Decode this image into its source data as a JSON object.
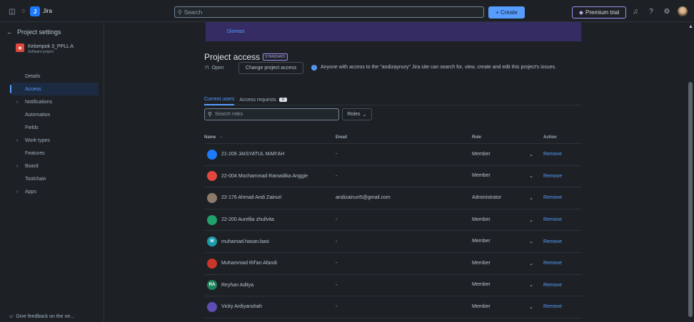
{
  "topbar": {
    "app_name": "Jira",
    "search_placeholder": "Search",
    "create_label": "+ Create",
    "premium_label": "Premium trial"
  },
  "sidebar": {
    "back_label": "Project settings",
    "project_name": "Kelompok 3_PPLL A",
    "project_type": "Software project",
    "items": [
      {
        "label": "Details",
        "chevron": false,
        "active": false
      },
      {
        "label": "Access",
        "chevron": false,
        "active": true
      },
      {
        "label": "Notifications",
        "chevron": true,
        "active": false
      },
      {
        "label": "Automation",
        "chevron": false,
        "active": false
      },
      {
        "label": "Fields",
        "chevron": false,
        "active": false
      },
      {
        "label": "Work types",
        "chevron": true,
        "active": false
      },
      {
        "label": "Features",
        "chevron": false,
        "active": false
      },
      {
        "label": "Board",
        "chevron": true,
        "active": false
      },
      {
        "label": "Toolchain",
        "chevron": false,
        "active": false
      },
      {
        "label": "Apps",
        "chevron": true,
        "active": false
      }
    ],
    "feedback_label": "Give feedback on the ne..."
  },
  "banner": {
    "dismiss_label": "Dismiss"
  },
  "access": {
    "title": "Project access",
    "badge": "STANDARD",
    "open_label": "Open",
    "change_label": "Change project access",
    "info_text": "Anyone with access to the \"andizaynury\" Jira site can search for, view, create and edit this project's issues."
  },
  "tabs": {
    "current_users": "Current users",
    "access_requests": "Access requests",
    "requests_count": "0"
  },
  "filters": {
    "search_placeholder": "Search roles",
    "roles_label": "Roles"
  },
  "table": {
    "headers": {
      "name": "Name",
      "email": "Email",
      "role": "Role",
      "action": "Action"
    },
    "rows": [
      {
        "name": "21-209 JAISYATUL MAR'AH",
        "email": "-",
        "role": "Member",
        "action": "Remove",
        "avatar_color": "#1d7afc",
        "initials": ""
      },
      {
        "name": "22-004 Mochammad Ramadika Anggie",
        "email": "-",
        "role": "Member",
        "action": "Remove",
        "avatar_color": "#e2483d",
        "initials": ""
      },
      {
        "name": "22-176 Ahmad Andi Zainuri",
        "email": "andizainuri5@gmail.com",
        "role": "Administrator",
        "action": "Remove",
        "avatar_color": "#8c7b6b",
        "initials": ""
      },
      {
        "name": "22-200 Aurellia zhullvita",
        "email": "-",
        "role": "Member",
        "action": "Remove",
        "avatar_color": "#22a06b",
        "initials": ""
      },
      {
        "name": "muhamad.hasan.basi",
        "email": "-",
        "role": "Member",
        "action": "Remove",
        "avatar_color": "#1d9aaa",
        "initials": "M"
      },
      {
        "name": "Muhammad Rif'an Afandi",
        "email": "-",
        "role": "Member",
        "action": "Remove",
        "avatar_color": "#c9372c",
        "initials": ""
      },
      {
        "name": "Reyhan Aditya",
        "email": "-",
        "role": "Member",
        "action": "Remove",
        "avatar_color": "#1f845a",
        "initials": "RA"
      },
      {
        "name": "Vicky Ardiyanshah",
        "email": "-",
        "role": "Member",
        "action": "Remove",
        "avatar_color": "#5e4db2",
        "initials": ""
      }
    ]
  }
}
